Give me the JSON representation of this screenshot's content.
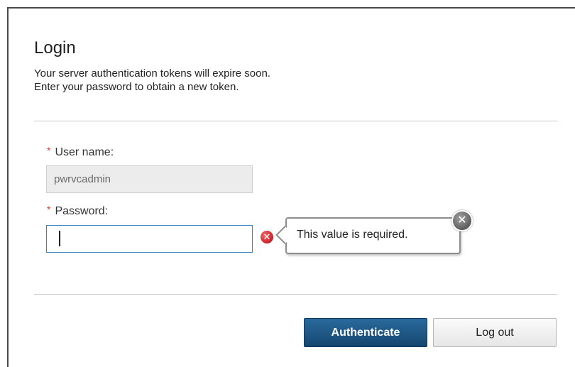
{
  "dialog": {
    "title": "Login",
    "message_line1": "Your server authentication tokens will expire soon.",
    "message_line2": "Enter your password to obtain a new token."
  },
  "form": {
    "username": {
      "required_mark": "*",
      "label": "User name:",
      "value": "pwrvcadmin"
    },
    "password": {
      "required_mark": "*",
      "label": "Password:",
      "value": ""
    }
  },
  "validation": {
    "error_icon": "error-x-icon",
    "message": "This value is required.",
    "close_icon": "close-icon"
  },
  "buttons": {
    "authenticate_label": "Authenticate",
    "logout_label": "Log out"
  },
  "colors": {
    "primary_button": "#14466f",
    "focus_border": "#3a86c4",
    "required_mark": "#d2442b",
    "error_icon": "#c8212a"
  }
}
